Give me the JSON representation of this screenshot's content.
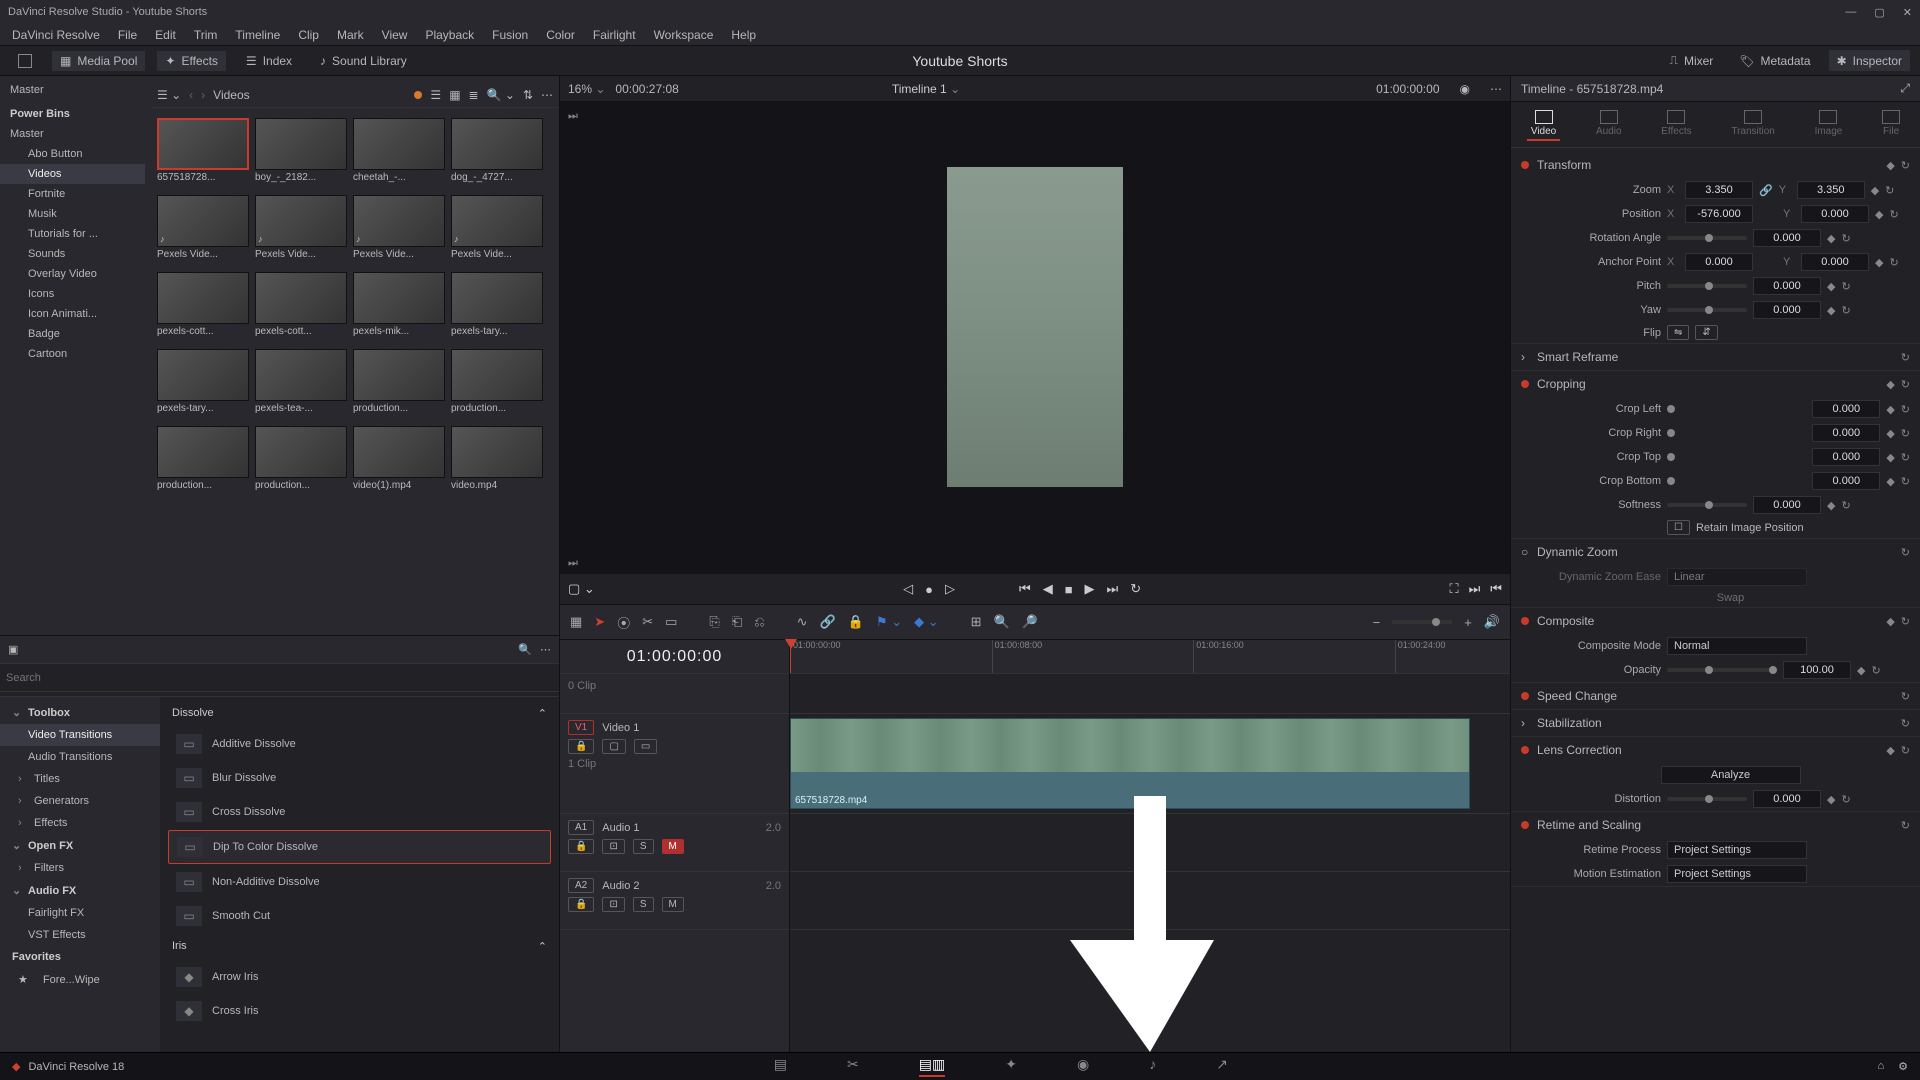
{
  "titlebar": {
    "title": "DaVinci Resolve Studio - Youtube Shorts"
  },
  "menus": [
    "DaVinci Resolve",
    "File",
    "Edit",
    "Trim",
    "Timeline",
    "Clip",
    "Mark",
    "View",
    "Playback",
    "Fusion",
    "Color",
    "Fairlight",
    "Workspace",
    "Help"
  ],
  "toolbar": {
    "media_pool": "Media Pool",
    "effects": "Effects",
    "index": "Index",
    "sound_library": "Sound Library",
    "center": "Youtube Shorts",
    "mixer": "Mixer",
    "metadata": "Metadata",
    "inspector": "Inspector"
  },
  "bins": {
    "master": "Master",
    "power": "Power Bins",
    "power_master": "Master",
    "children": [
      "Abo Button",
      "Videos",
      "Fortnite",
      "Musik",
      "Tutorials for ...",
      "Sounds",
      "Overlay Video",
      "Icons",
      "Icon Animati...",
      "Badge",
      "Cartoon"
    ]
  },
  "mediaHeader": {
    "title": "Videos"
  },
  "thumbs": [
    "657518728...",
    "boy_-_2182...",
    "cheetah_-...",
    "dog_-_4727...",
    "Pexels Vide...",
    "Pexels Vide...",
    "Pexels Vide...",
    "Pexels Vide...",
    "pexels-cott...",
    "pexels-cott...",
    "pexels-mik...",
    "pexels-tary...",
    "pexels-tary...",
    "pexels-tea-...",
    "production...",
    "production...",
    "production...",
    "production...",
    "video(1).mp4",
    "video.mp4"
  ],
  "fxSearch": {
    "placeholder": "Search"
  },
  "fxTree": {
    "toolbox": "Toolbox",
    "vt": "Video Transitions",
    "at": "Audio Transitions",
    "titles": "Titles",
    "gen": "Generators",
    "eff": "Effects",
    "openfx": "Open FX",
    "filters": "Filters",
    "audiofx": "Audio FX",
    "fair": "Fairlight FX",
    "vst": "VST Effects",
    "fav": "Favorites",
    "favitem": "Fore...Wipe"
  },
  "fxList": {
    "cat1": "Dissolve",
    "items1": [
      "Additive Dissolve",
      "Blur Dissolve",
      "Cross Dissolve",
      "Dip To Color Dissolve",
      "Non-Additive Dissolve",
      "Smooth Cut"
    ],
    "cat2": "Iris",
    "items2": [
      "Arrow Iris",
      "Cross Iris"
    ]
  },
  "viewer": {
    "zoom": "16%",
    "tc_src": "00:00:27:08",
    "timeline_name": "Timeline 1",
    "tc_rec": "01:00:00:00"
  },
  "timeline": {
    "big_tc": "01:00:00:00",
    "ruler": [
      "01:00:00:00",
      "01:00:08:00",
      "01:00:16:00",
      "01:00:24:00"
    ],
    "v1": "V1",
    "v1name": "Video 1",
    "v1_sub": "0 Clip",
    "v1_sub2": "1 Clip",
    "a1": "A1",
    "a1name": "Audio 1",
    "a1_lvl": "2.0",
    "a2": "A2",
    "a2name": "Audio 2",
    "a2_lvl": "2.0",
    "clip_name": "657518728.mp4"
  },
  "inspector": {
    "head": "Timeline - 657518728.mp4",
    "tabs": [
      "Video",
      "Audio",
      "Effects",
      "Transition",
      "Image",
      "File"
    ],
    "transform": {
      "label": "Transform",
      "zoom_l": "Zoom",
      "zoom_x": "3.350",
      "zoom_y": "3.350",
      "pos_l": "Position",
      "pos_x": "-576.000",
      "pos_y": "0.000",
      "rot_l": "Rotation Angle",
      "rot": "0.000",
      "anchor_l": "Anchor Point",
      "anchor_x": "0.000",
      "anchor_y": "0.000",
      "pitch_l": "Pitch",
      "pitch": "0.000",
      "yaw_l": "Yaw",
      "yaw": "0.000",
      "flip_l": "Flip"
    },
    "smart": "Smart Reframe",
    "crop": {
      "label": "Cropping",
      "left_l": "Crop Left",
      "left": "0.000",
      "right_l": "Crop Right",
      "right": "0.000",
      "top_l": "Crop Top",
      "top": "0.000",
      "bottom_l": "Crop Bottom",
      "bottom": "0.000",
      "soft_l": "Softness",
      "soft": "0.000",
      "retain": "Retain Image Position"
    },
    "dz": {
      "label": "Dynamic Zoom",
      "ease_l": "Dynamic Zoom Ease",
      "ease": "Linear",
      "swap": "Swap"
    },
    "comp": {
      "label": "Composite",
      "mode_l": "Composite Mode",
      "mode": "Normal",
      "op_l": "Opacity",
      "op": "100.00"
    },
    "speed": "Speed Change",
    "stab": "Stabilization",
    "lens": {
      "label": "Lens Correction",
      "analyze": "Analyze",
      "dist_l": "Distortion",
      "dist": "0.000"
    },
    "retime": {
      "label": "Retime and Scaling",
      "proc_l": "Retime Process",
      "proc": "Project Settings",
      "mot_l": "Motion Estimation",
      "mot": "Project Settings"
    }
  },
  "pagebar": {
    "version": "DaVinci Resolve 18"
  }
}
